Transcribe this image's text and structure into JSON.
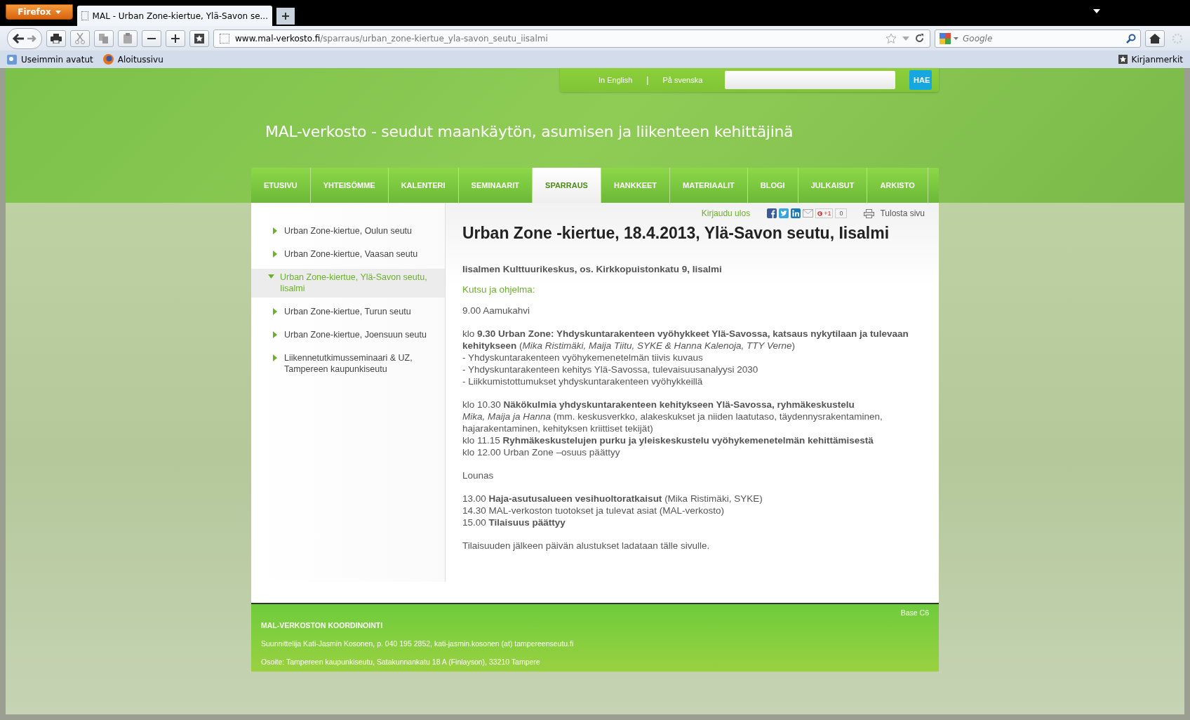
{
  "browser": {
    "menu_button": "Firefox",
    "tab_title": "MAL - Urban Zone-kiertue, Ylä-Savon se...",
    "url_host": "www.mal-verkosto.fi",
    "url_path": "/sparraus/urban_zone-kiertue_yla-savon_seutu_iisalmi",
    "search_placeholder": "Google",
    "bookmarks": [
      "Useimmin avatut",
      "Aloitussivu"
    ],
    "bookmarks_menu": "Kirjanmerkit"
  },
  "topbar": {
    "languages": [
      "In English",
      "På svenska"
    ],
    "separator": "|",
    "search_button": "HAE"
  },
  "site_title": "MAL-verkosto - seudut maankäytön, asumisen ja liikenteen kehittäjinä",
  "nav": [
    {
      "label": "ETUSIVU",
      "selected": false
    },
    {
      "label": "YHTEISÖMME",
      "selected": false
    },
    {
      "label": "KALENTERI",
      "selected": false
    },
    {
      "label": "SEMINAARIT",
      "selected": false
    },
    {
      "label": "SPARRAUS",
      "selected": true
    },
    {
      "label": "HANKKEET",
      "selected": false
    },
    {
      "label": "MATERIAALIT",
      "selected": false
    },
    {
      "label": "BLOGI",
      "selected": false
    },
    {
      "label": "JULKAISUT",
      "selected": false
    },
    {
      "label": "ARKISTO",
      "selected": false
    }
  ],
  "sidebar": [
    {
      "label": "Urban Zone-kiertue, Oulun seutu",
      "selected": false
    },
    {
      "label": "Urban Zone-kiertue, Vaasan seutu",
      "selected": false
    },
    {
      "label": "Urban Zone-kiertue, Ylä-Savon seutu, Iisalmi",
      "selected": true
    },
    {
      "label": "Urban Zone-kiertue, Turun seutu",
      "selected": false
    },
    {
      "label": "Urban Zone-kiertue, Joensuun seutu",
      "selected": false
    },
    {
      "label": "Liikennetutkimusseminaari & UZ, Tampereen kaupunkiseutu",
      "selected": false
    }
  ],
  "tools": {
    "logout": "Kirjaudu ulos",
    "gplus_label": "+1",
    "gplus_count": "0",
    "print": "Tulosta sivu"
  },
  "article": {
    "title": "Urban Zone -kiertue, 18.4.2013, Ylä-Savon seutu, Iisalmi",
    "venue": "Iisalmen Kulttuurikeskus, os. Kirkkopuistonkatu 9, Iisalmi",
    "subheading": "Kutsu ja ohjelma:",
    "blocks": [
      [
        "9.00 Aamukahvi"
      ],
      [
        "klo **9.30 Urban Zone: Yhdyskuntarakenteen vyöhykkeet Ylä-Savossa, katsaus nykytilaan ja tulevaan kehitykseen** (*Mika Ristimäki, Maija Tiitu, SYKE & Hanna Kalenoja, TTY Verne*)",
        "- Yhdyskuntarakenteen vyöhykemenetelmän tiivis kuvaus",
        "- Yhdyskuntarakenteen kehitys Ylä-Savossa, tulevaisuusanalyysi 2030",
        "- Liikkumistottumukset yhdyskuntarakenteen vyöhykkeillä"
      ],
      [
        "klo 10.30 **Näkökulmia yhdyskuntarakenteen kehitykseen Ylä-Savossa, ryhmäkeskustelu**",
        "*Mika, Maija ja Hanna*  (mm. keskusverkko, alakeskukset ja niiden laatutaso, täydennysrakentaminen, hajarakentaminen, kehityksen kriittiset tekijät)",
        "klo 11.15 **Ryhmäkeskustelujen purku ja yleiskeskustelu vyöhykemenetelmän kehittämisestä**",
        "klo 12.00 Urban Zone –osuus päättyy"
      ],
      [
        "Lounas"
      ],
      [
        "13.00 **Haja-asutusalueen vesihuoltoratkaisut** (Mika Ristimäki, SYKE)",
        "14.30 MAL-verkoston tuotokset ja tulevat asiat  (MAL-verkosto)",
        "15.00 **Tilaisuus päättyy**"
      ],
      [
        "Tilaisuuden jälkeen päivän alustukset ladataan tälle sivulle."
      ]
    ]
  },
  "footer": {
    "version": "Base C6",
    "heading": "MAL-VERKOSTON KOORDINOINTI",
    "lines": [
      "Suunnittelija Kati-Jasmin Kosonen, p. 040 195 2852, kati-jasmin.kosonen (at) tampereenseutu.fi",
      "Osoite: Tampereen kaupunkiseutu, Satakunnankatu 18 A (Finlayson), 33210 Tampere"
    ]
  }
}
